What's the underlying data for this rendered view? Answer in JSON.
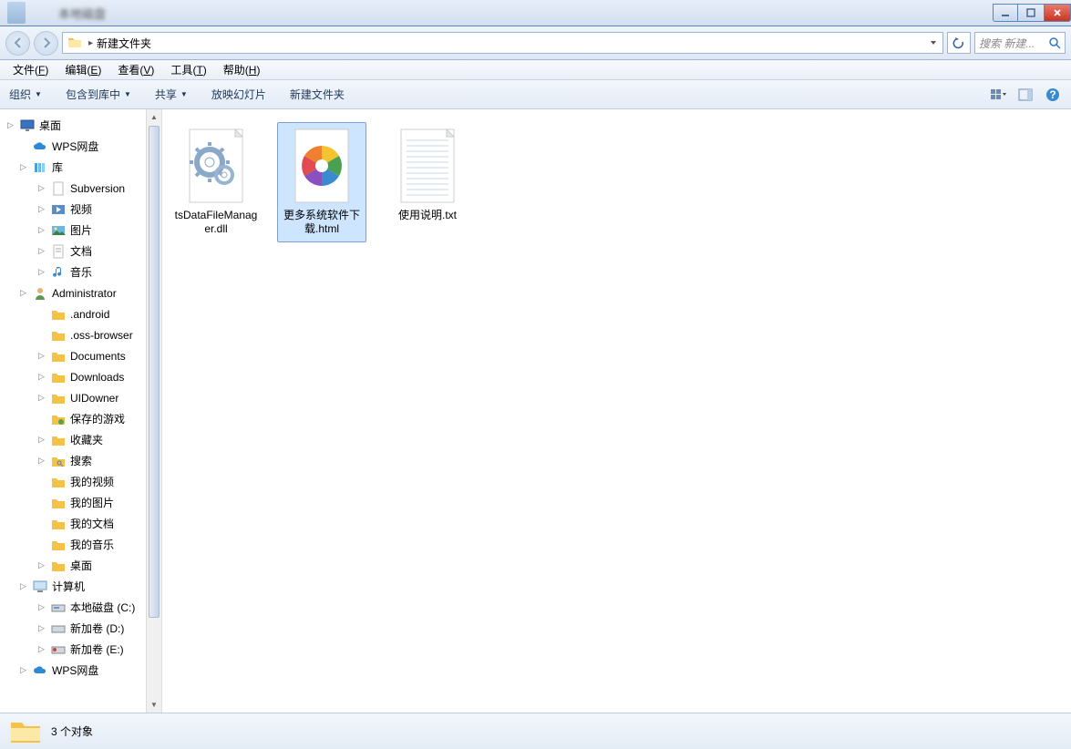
{
  "title_blurred": "本地磁盘",
  "breadcrumb": {
    "current": "新建文件夹"
  },
  "search": {
    "placeholder": "搜索 新建...",
    "icon": "search"
  },
  "menus": [
    {
      "label": "文件",
      "key": "F"
    },
    {
      "label": "编辑",
      "key": "E"
    },
    {
      "label": "查看",
      "key": "V"
    },
    {
      "label": "工具",
      "key": "T"
    },
    {
      "label": "帮助",
      "key": "H"
    }
  ],
  "toolbar": {
    "organize": "组织",
    "include": "包含到库中",
    "share": "共享",
    "slideshow": "放映幻灯片",
    "newfolder": "新建文件夹"
  },
  "tree": {
    "desktop": "桌面",
    "wps": "WPS网盘",
    "libraries": "库",
    "lib_children": [
      "Subversion",
      "视频",
      "图片",
      "文档",
      "音乐"
    ],
    "administrator": "Administrator",
    "admin_children": [
      ".android",
      ".oss-browser",
      "Documents",
      "Downloads",
      "UIDowner",
      "保存的游戏",
      "收藏夹",
      "搜索",
      "我的视频",
      "我的图片",
      "我的文档",
      "我的音乐",
      "桌面"
    ],
    "computer": "计算机",
    "drives": [
      "本地磁盘 (C:)",
      "新加卷 (D:)",
      "新加卷 (E:)"
    ],
    "wps2": "WPS网盘"
  },
  "files": [
    {
      "name": "tsDataFileManager.dll",
      "type": "dll",
      "selected": false
    },
    {
      "name": "更多系统软件下载.html",
      "type": "html",
      "selected": true
    },
    {
      "name": "使用说明.txt",
      "type": "txt",
      "selected": false
    }
  ],
  "status": {
    "count_label": "3 个对象"
  }
}
